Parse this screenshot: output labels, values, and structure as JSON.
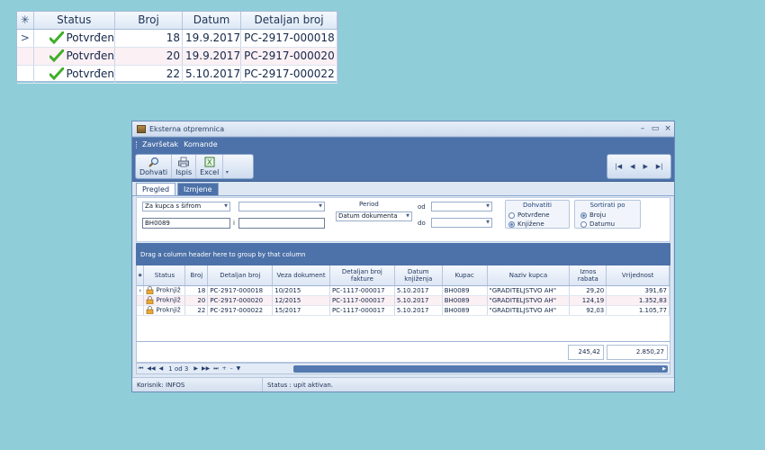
{
  "zoom_grid": {
    "headers": {
      "status": "Status",
      "broj": "Broj",
      "datum": "Datum",
      "detaljan_broj": "Detaljan broj"
    },
    "indicator_header": "✳",
    "row_pointer": ">",
    "rows": [
      {
        "status": "Potvrđen",
        "broj": "18",
        "datum": "19.9.2017",
        "detaljan_broj": "PC-2917-000018"
      },
      {
        "status": "Potvrđen",
        "broj": "20",
        "datum": "19.9.2017",
        "detaljan_broj": "PC-2917-000020"
      },
      {
        "status": "Potvrđen",
        "broj": "22",
        "datum": "5.10.2017",
        "detaljan_broj": "PC-2917-000022"
      }
    ]
  },
  "window": {
    "title": "Eksterna otpremnica",
    "controls": {
      "minimize": "–",
      "maximize": "▭",
      "close": "×"
    },
    "menu": [
      "Završetak",
      "Komande"
    ],
    "toolbar": {
      "dohvati": "Dohvati",
      "ispis": "Ispis",
      "excel": "Excel"
    },
    "nav_buttons": {
      "first": "|◀",
      "prev": "◀",
      "next": "▶",
      "last": "▶|"
    },
    "tabs": [
      "Pregled",
      "Izmjene"
    ],
    "filter": {
      "kupac_combo": "Za kupca s šifrom",
      "kupac_value": "BH0089",
      "second_combo": "",
      "i_label": "i",
      "i_value": "",
      "period_label": "Period",
      "period_combo": "Datum dokumenta",
      "od_label": "od",
      "do_label": "do",
      "od_value": "",
      "do_value": "",
      "dohvatiti_title": "Dohvatiti",
      "dohvatiti_options": [
        "Potvrđene",
        "Knjižene"
      ],
      "dohvatiti_selected": "Knjižene",
      "sortirati_title": "Sortirati po",
      "sortirati_options": [
        "Broju",
        "Datumu"
      ],
      "sortirati_selected": "Broju"
    },
    "group_band": "Drag a column header here to group by that column",
    "grid": {
      "headers": {
        "status": "Status",
        "broj": "Broj",
        "detaljan_broj": "Detaljan broj",
        "veza": "Veza dokument",
        "det_fakture": "Detaljan broj fakture",
        "datum_knjizenja": "Datum knjiženja",
        "kupac": "Kupac",
        "naziv": "Naziv kupca",
        "iznos_rabata": "Iznos rabata",
        "vrijednost": "Vrijednost"
      },
      "rows": [
        {
          "status": "Proknjiž",
          "broj": "18",
          "detaljan_broj": "PC-2917-000018",
          "veza": "10/2015",
          "det_fakture": "PC-1117-000017",
          "datum_knjizenja": "5.10.2017",
          "kupac": "BH0089",
          "naziv": "\"GRADITELJSTVO AH\"",
          "iznos_rabata": "29,20",
          "vrijednost": "391,67"
        },
        {
          "status": "Proknjiž",
          "broj": "20",
          "detaljan_broj": "PC-2917-000020",
          "veza": "12/2015",
          "det_fakture": "PC-1117-000017",
          "datum_knjizenja": "5.10.2017",
          "kupac": "BH0089",
          "naziv": "\"GRADITELJSTVO AH\"",
          "iznos_rabata": "124,19",
          "vrijednost": "1.352,83"
        },
        {
          "status": "Proknjiž",
          "broj": "22",
          "detaljan_broj": "PC-2917-000022",
          "veza": "15/2017",
          "det_fakture": "PC-1117-000017",
          "datum_knjizenja": "5.10.2017",
          "kupac": "BH0089",
          "naziv": "\"GRADITELJSTVO AH\"",
          "iznos_rabata": "92,03",
          "vrijednost": "1.105,77"
        }
      ],
      "totals": {
        "iznos_rabata": "245,42",
        "vrijednost": "2.850,27"
      }
    },
    "pager": {
      "position": "1 od 3"
    },
    "status_bar": {
      "user": "Korisnik: INFOS",
      "status": "Status : upit aktivan."
    }
  },
  "colors": {
    "background": "#8fcdd9",
    "band": "#4d72a9",
    "alt_row": "#fbf0f4",
    "check": "#3fae2a"
  }
}
